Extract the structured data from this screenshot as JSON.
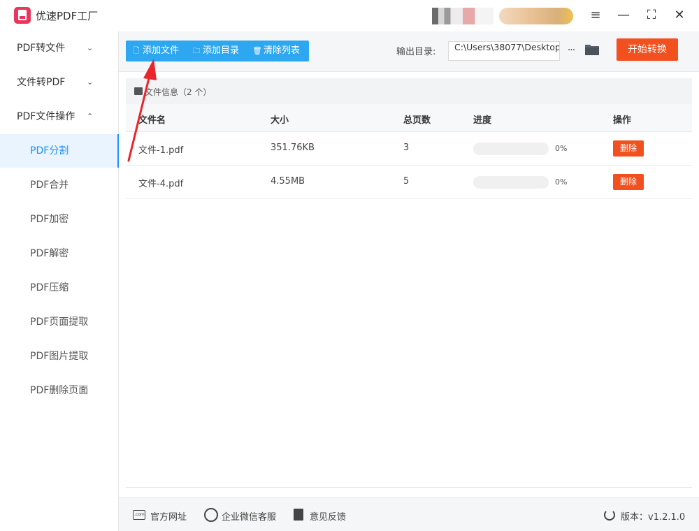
{
  "app": {
    "title": "优速PDF工厂"
  },
  "window_controls": {
    "menu": "≡",
    "minimize": "—",
    "maximize": "⛶",
    "close": "✕"
  },
  "sidebar": {
    "groups": [
      {
        "label": "PDF转文件",
        "chevron": "⌄"
      },
      {
        "label": "文件转PDF",
        "chevron": "⌄"
      },
      {
        "label": "PDF文件操作",
        "chevron": "⌃"
      }
    ],
    "items": [
      {
        "label": "PDF分割",
        "active": true
      },
      {
        "label": "PDF合并"
      },
      {
        "label": "PDF加密"
      },
      {
        "label": "PDF解密"
      },
      {
        "label": "PDF压缩"
      },
      {
        "label": "PDF页面提取"
      },
      {
        "label": "PDF图片提取"
      },
      {
        "label": "PDF删除页面"
      }
    ]
  },
  "toolbar": {
    "add_file": "添加文件",
    "add_dir": "添加目录",
    "clear_list": "清除列表",
    "output_label": "输出目录:",
    "output_path": "C:\\Users\\38077\\Desktop",
    "more": "···",
    "start": "开始转换"
  },
  "file_info": {
    "label": "文件信息（2 个）"
  },
  "table": {
    "headers": [
      "文件名",
      "大小",
      "总页数",
      "进度",
      "操作"
    ],
    "rows": [
      {
        "name": "文件-1.pdf",
        "size": "351.76KB",
        "pages": "3",
        "progress": 0,
        "progress_text": "0%",
        "action": "删除"
      },
      {
        "name": "文件-4.pdf",
        "size": "4.55MB",
        "pages": "5",
        "progress": 0,
        "progress_text": "0%",
        "action": "删除"
      }
    ]
  },
  "footer": {
    "website": "官方网址",
    "wechat": "企业微信客服",
    "feedback": "意见反馈",
    "version": "版本：v1.2.1.0"
  },
  "colors": {
    "accent": "#2ea7f1",
    "danger": "#f2501f",
    "sidebar_active": "#1e90ff",
    "annotation": "#e8262b"
  }
}
